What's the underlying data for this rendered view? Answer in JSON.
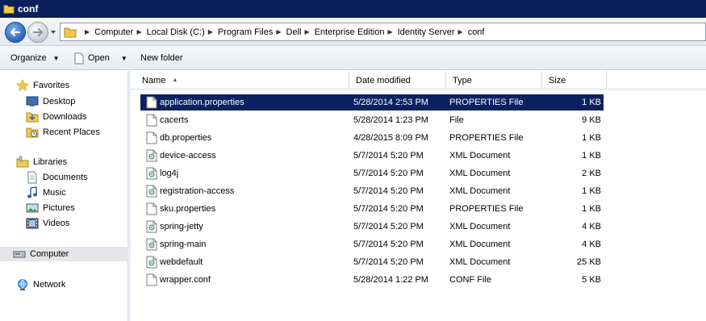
{
  "window": {
    "title": "conf"
  },
  "address": {
    "breadcrumbs": [
      "Computer",
      "Local Disk (C:)",
      "Program Files",
      "Dell",
      "Enterprise Edition",
      "Identity Server",
      "conf"
    ]
  },
  "toolbar": {
    "organize": "Organize",
    "open": "Open",
    "new_folder": "New folder"
  },
  "nav": {
    "favorites": "Favorites",
    "desktop": "Desktop",
    "downloads": "Downloads",
    "recent_places": "Recent Places",
    "libraries": "Libraries",
    "documents": "Documents",
    "music": "Music",
    "pictures": "Pictures",
    "videos": "Videos",
    "computer": "Computer",
    "network": "Network"
  },
  "columns": {
    "name": "Name",
    "date_modified": "Date modified",
    "type": "Type",
    "size": "Size"
  },
  "files": [
    {
      "name": "application.properties",
      "date": "5/28/2014 2:53 PM",
      "type": "PROPERTIES File",
      "size": "1 KB",
      "icon": "document-icon",
      "selected": true
    },
    {
      "name": "cacerts",
      "date": "5/28/2014 1:23 PM",
      "type": "File",
      "size": "9 KB",
      "icon": "document-icon"
    },
    {
      "name": "db.properties",
      "date": "4/28/2015 8:09 PM",
      "type": "PROPERTIES File",
      "size": "1 KB",
      "icon": "document-icon"
    },
    {
      "name": "device-access",
      "date": "5/7/2014 5:20 PM",
      "type": "XML Document",
      "size": "1 KB",
      "icon": "xml-icon"
    },
    {
      "name": "log4j",
      "date": "5/7/2014 5:20 PM",
      "type": "XML Document",
      "size": "2 KB",
      "icon": "xml-icon"
    },
    {
      "name": "registration-access",
      "date": "5/7/2014 5:20 PM",
      "type": "XML Document",
      "size": "1 KB",
      "icon": "xml-icon"
    },
    {
      "name": "sku.properties",
      "date": "5/7/2014 5:20 PM",
      "type": "PROPERTIES File",
      "size": "1 KB",
      "icon": "document-icon"
    },
    {
      "name": "spring-jetty",
      "date": "5/7/2014 5:20 PM",
      "type": "XML Document",
      "size": "4 KB",
      "icon": "xml-icon"
    },
    {
      "name": "spring-main",
      "date": "5/7/2014 5:20 PM",
      "type": "XML Document",
      "size": "4 KB",
      "icon": "xml-icon"
    },
    {
      "name": "webdefault",
      "date": "5/7/2014 5:20 PM",
      "type": "XML Document",
      "size": "25 KB",
      "icon": "xml-icon"
    },
    {
      "name": "wrapper.conf",
      "date": "5/28/2014 1:22 PM",
      "type": "CONF File",
      "size": "5 KB",
      "icon": "document-icon"
    }
  ],
  "colors": {
    "titlebar": "#0b1f5c",
    "selection": "#0b2160",
    "nav_selected": "#e4e6ea"
  }
}
